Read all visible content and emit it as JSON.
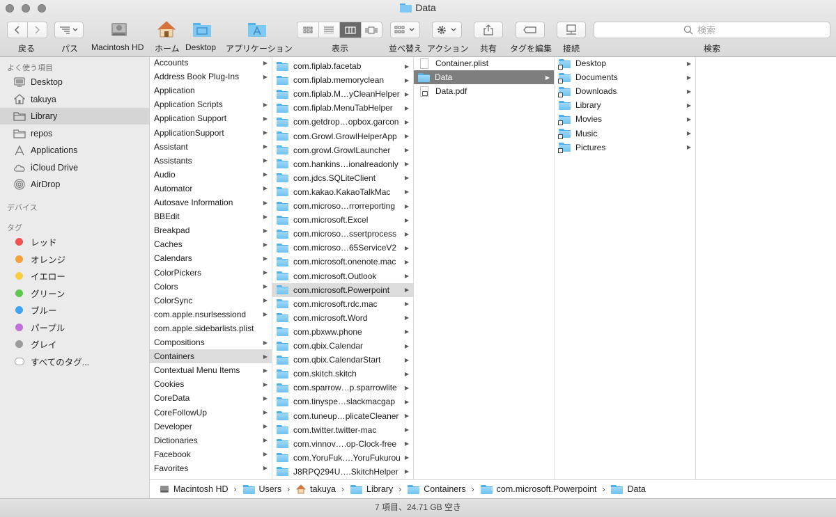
{
  "window": {
    "title": "Data"
  },
  "toolbar": {
    "back_label": "戻る",
    "path_label": "パス",
    "macintosh_hd_label": "Macintosh HD",
    "home_label": "ホーム",
    "desktop_label": "Desktop",
    "applications_label": "アプリケーション",
    "view_label": "表示",
    "arrange_label": "並べ替え",
    "action_label": "アクション",
    "share_label": "共有",
    "tags_label": "タグを編集",
    "connect_label": "接続",
    "search_label": "検索",
    "search_placeholder": "検索"
  },
  "sidebar": {
    "favorites_header": "よく使う項目",
    "favorites": [
      {
        "label": "Desktop",
        "icon": "desktop-icon"
      },
      {
        "label": "takuya",
        "icon": "home-icon"
      },
      {
        "label": "Library",
        "icon": "folder-icon",
        "selected": true
      },
      {
        "label": "repos",
        "icon": "folder-icon"
      },
      {
        "label": "Applications",
        "icon": "applications-icon"
      },
      {
        "label": "iCloud Drive",
        "icon": "cloud-icon"
      },
      {
        "label": "AirDrop",
        "icon": "airdrop-icon"
      }
    ],
    "devices_header": "デバイス",
    "tags_header": "タグ",
    "tags": [
      {
        "label": "レッド",
        "color": "#f0524f"
      },
      {
        "label": "オレンジ",
        "color": "#f4a13c"
      },
      {
        "label": "イエロー",
        "color": "#f6cf43"
      },
      {
        "label": "グリーン",
        "color": "#5ec74e"
      },
      {
        "label": "ブルー",
        "color": "#3ea5f4"
      },
      {
        "label": "パープル",
        "color": "#c071d9"
      },
      {
        "label": "グレイ",
        "color": "#9b9b9b"
      }
    ],
    "all_tags_label": "すべてのタグ..."
  },
  "columns": {
    "library": [
      "Accounts",
      "Address Book Plug-Ins",
      "Application",
      "Application Scripts",
      "Application Support",
      "ApplicationSupport",
      "Assistant",
      "Assistants",
      "Audio",
      "Automator",
      "Autosave Information",
      "BBEdit",
      "Breakpad",
      "Caches",
      "Calendars",
      "ColorPickers",
      "Colors",
      "ColorSync",
      "com.apple.nsurlsessiond",
      "com.apple.sidebarlists.plist",
      "Compositions",
      "Containers",
      "Contextual Menu Items",
      "Cookies",
      "CoreData",
      "CoreFollowUp",
      "Developer",
      "Dictionaries",
      "Facebook",
      "Favorites"
    ],
    "library_selected": "Containers",
    "library_no_chevron": [
      "Application",
      "com.apple.sidebarlists.plist"
    ],
    "containers": [
      "com.fiplab.facetab",
      "com.fiplab.memoryclean",
      "com.fiplab.M…yCleanHelper",
      "com.fiplab.MenuTabHelper",
      "com.getdrop…opbox.garcon",
      "com.Growl.GrowlHelperApp",
      "com.growl.GrowlLauncher",
      "com.hankins…ionalreadonly",
      "com.jdcs.SQLiteClient",
      "com.kakao.KakaoTalkMac",
      "com.microso…rrorreporting",
      "com.microsoft.Excel",
      "com.microso…ssertprocess",
      "com.microso…65ServiceV2",
      "com.microsoft.onenote.mac",
      "com.microsoft.Outlook",
      "com.microsoft.Powerpoint",
      "com.microsoft.rdc.mac",
      "com.microsoft.Word",
      "com.pbxww.phone",
      "com.qbix.Calendar",
      "com.qbix.CalendarStart",
      "com.skitch.skitch",
      "com.sparrow…p.sparrowlite",
      "com.tinyspe…slackmacgap",
      "com.tuneup…plicateCleaner",
      "com.twitter.twitter-mac",
      "com.vinnov….op-Clock-free",
      "com.YoruFuk….YoruFukurou",
      "J8RPQ294U….SkitchHelper"
    ],
    "containers_selected": "com.microsoft.Powerpoint",
    "powerpoint": [
      {
        "label": "Container.plist",
        "kind": "plist"
      },
      {
        "label": "Data",
        "kind": "folder",
        "selected": true
      },
      {
        "label": "Data.pdf",
        "kind": "pdf"
      }
    ],
    "data": [
      "Desktop",
      "Documents",
      "Downloads",
      "Library",
      "Movies",
      "Music",
      "Pictures"
    ]
  },
  "pathbar": [
    "Macintosh HD",
    "Users",
    "takuya",
    "Library",
    "Containers",
    "com.microsoft.Powerpoint",
    "Data"
  ],
  "status": {
    "text": "7 項目、24.71 GB 空き"
  }
}
